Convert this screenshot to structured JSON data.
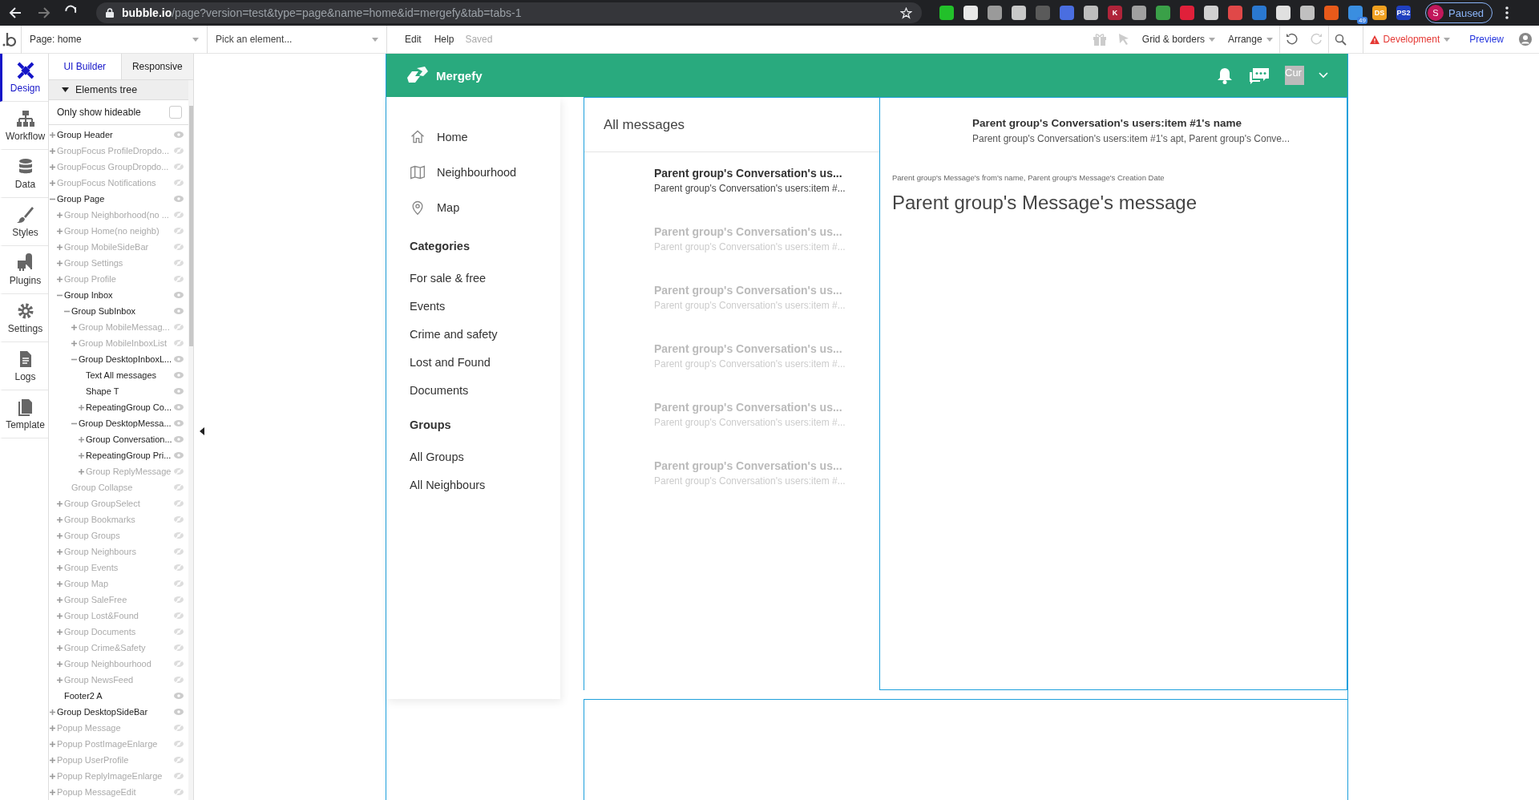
{
  "browser": {
    "url_host": "bubble.io",
    "url_path": "/page?version=test&type=page&name=home&id=mergefy&tab=tabs-1",
    "extensions": [
      {
        "color": "#22c02a"
      },
      {
        "color": "#e8e8e8"
      },
      {
        "color": "#9a9a9a"
      },
      {
        "color": "#c8c8c8"
      },
      {
        "color": "#5a5a5a"
      },
      {
        "color": "#4a6ee0"
      },
      {
        "color": "#bdbdbd"
      },
      {
        "color": "#b0243a",
        "text": "K"
      },
      {
        "color": "#a0a0a0"
      },
      {
        "color": "#3aa048"
      },
      {
        "color": "#e0203a"
      },
      {
        "color": "#d0d0d0"
      },
      {
        "color": "#e04848"
      },
      {
        "color": "#2a78d0"
      },
      {
        "color": "#e0e0e0"
      },
      {
        "color": "#c0c0c0"
      },
      {
        "color": "#e85a1a"
      },
      {
        "color": "#3a8ee0",
        "badge": "49"
      },
      {
        "color": "#f0a020",
        "text": "DS"
      },
      {
        "color": "#2040c0",
        "text": "PS2"
      }
    ],
    "profile": {
      "initial": "S",
      "label": "Paused"
    }
  },
  "editor_toolbar": {
    "page": "Page: home",
    "element_placeholder": "Pick an element...",
    "menus": [
      "Edit",
      "Help"
    ],
    "status": "Saved",
    "right_menus": [
      "Grid & borders",
      "Arrange"
    ],
    "mode": "Development",
    "preview": "Preview"
  },
  "rail": [
    {
      "label": "Design",
      "selected": true
    },
    {
      "label": "Workflow",
      "selected": false
    },
    {
      "label": "Data",
      "selected": false
    },
    {
      "label": "Styles",
      "selected": false
    },
    {
      "label": "Plugins",
      "selected": false
    },
    {
      "label": "Settings",
      "selected": false
    },
    {
      "label": "Logs",
      "selected": false
    },
    {
      "label": "Template",
      "selected": false
    }
  ],
  "panel_tabs": [
    {
      "label": "UI Builder",
      "selected": true
    },
    {
      "label": "Responsive",
      "selected": false
    }
  ],
  "tree_header": "Elements tree",
  "hideable": {
    "label": "Only show hideable",
    "checked": false
  },
  "tree": [
    {
      "label": "Group Header",
      "kind": "group",
      "expanded": false,
      "hidden": false
    },
    {
      "label": "GroupFocus ProfileDropdo...",
      "kind": "group",
      "expanded": false,
      "hidden": true
    },
    {
      "label": "GroupFocus GroupDropdo...",
      "kind": "group",
      "expanded": false,
      "hidden": true
    },
    {
      "label": "GroupFocus Notifications",
      "kind": "group",
      "expanded": false,
      "hidden": true
    },
    {
      "label": "Group Page",
      "kind": "group",
      "expanded": true,
      "hidden": false,
      "children": [
        {
          "label": "Group Neighborhood(no ...",
          "kind": "group",
          "expanded": false,
          "hidden": true
        },
        {
          "label": "Group Home(no neighb)",
          "kind": "group",
          "expanded": false,
          "hidden": true
        },
        {
          "label": "Group MobileSideBar",
          "kind": "group",
          "expanded": false,
          "hidden": true
        },
        {
          "label": "Group Settings",
          "kind": "group",
          "expanded": false,
          "hidden": true
        },
        {
          "label": "Group Profile",
          "kind": "group",
          "expanded": false,
          "hidden": true
        },
        {
          "label": "Group Inbox",
          "kind": "group",
          "expanded": true,
          "hidden": false,
          "children": [
            {
              "label": "Group SubInbox",
              "kind": "group",
              "expanded": true,
              "hidden": false,
              "children": [
                {
                  "label": "Group MobileMessag...",
                  "kind": "group",
                  "expanded": false,
                  "hidden": true
                },
                {
                  "label": "Group MobileInboxList",
                  "kind": "group",
                  "expanded": false,
                  "hidden": true
                },
                {
                  "label": "Group DesktopInboxL...",
                  "kind": "group",
                  "expanded": true,
                  "hidden": false,
                  "children": [
                    {
                      "label": "Text All messages",
                      "kind": "leaf",
                      "hidden": false
                    },
                    {
                      "label": "Shape T",
                      "kind": "leaf",
                      "hidden": false
                    },
                    {
                      "label": "RepeatingGroup Co...",
                      "kind": "group",
                      "expanded": false,
                      "hidden": false
                    }
                  ]
                },
                {
                  "label": "Group DesktopMessa...",
                  "kind": "group",
                  "expanded": true,
                  "hidden": false,
                  "children": [
                    {
                      "label": "Group Conversation...",
                      "kind": "group",
                      "expanded": false,
                      "hidden": false
                    },
                    {
                      "label": "RepeatingGroup Pri...",
                      "kind": "group",
                      "expanded": false,
                      "hidden": false
                    },
                    {
                      "label": "Group ReplyMessage",
                      "kind": "group",
                      "expanded": false,
                      "hidden": true
                    }
                  ]
                }
              ]
            },
            {
              "label": "Group Collapse",
              "kind": "leaf",
              "hidden": true
            }
          ]
        },
        {
          "label": "Group GroupSelect",
          "kind": "group",
          "expanded": false,
          "hidden": true
        },
        {
          "label": "Group Bookmarks",
          "kind": "group",
          "expanded": false,
          "hidden": true
        },
        {
          "label": "Group Groups",
          "kind": "group",
          "expanded": false,
          "hidden": true
        },
        {
          "label": "Group Neighbours",
          "kind": "group",
          "expanded": false,
          "hidden": true
        },
        {
          "label": "Group Events",
          "kind": "group",
          "expanded": false,
          "hidden": true
        },
        {
          "label": "Group Map",
          "kind": "group",
          "expanded": false,
          "hidden": true
        },
        {
          "label": "Group SaleFree",
          "kind": "group",
          "expanded": false,
          "hidden": true
        },
        {
          "label": "Group Lost&Found",
          "kind": "group",
          "expanded": false,
          "hidden": true
        },
        {
          "label": "Group Documents",
          "kind": "group",
          "expanded": false,
          "hidden": true
        },
        {
          "label": "Group Crime&Safety",
          "kind": "group",
          "expanded": false,
          "hidden": true
        },
        {
          "label": "Group Neighbourhood",
          "kind": "group",
          "expanded": false,
          "hidden": true
        },
        {
          "label": "Group NewsFeed",
          "kind": "group",
          "expanded": false,
          "hidden": true
        },
        {
          "label": "Footer2 A",
          "kind": "leaf",
          "hidden": false
        }
      ]
    },
    {
      "label": "Group DesktopSideBar",
      "kind": "group",
      "expanded": false,
      "hidden": false
    },
    {
      "label": "Popup Message",
      "kind": "group",
      "expanded": false,
      "hidden": true
    },
    {
      "label": "Popup PostImageEnlarge",
      "kind": "group",
      "expanded": false,
      "hidden": true
    },
    {
      "label": "Popup UserProfile",
      "kind": "group",
      "expanded": false,
      "hidden": true
    },
    {
      "label": "Popup ReplyImageEnlarge",
      "kind": "group",
      "expanded": false,
      "hidden": true
    },
    {
      "label": "Popup MessageEdit",
      "kind": "group",
      "expanded": false,
      "hidden": true
    }
  ],
  "app": {
    "brand": "Mergefy",
    "avatar_text": "Cur",
    "nav": [
      {
        "kind": "icon-link",
        "label": "Home"
      },
      {
        "kind": "icon-link",
        "label": "Neighbourhood"
      },
      {
        "kind": "icon-link",
        "label": "Map"
      },
      {
        "kind": "heading",
        "label": "Categories"
      },
      {
        "kind": "link",
        "label": "For sale & free"
      },
      {
        "kind": "link",
        "label": "Events"
      },
      {
        "kind": "link",
        "label": "Crime and safety"
      },
      {
        "kind": "link",
        "label": "Lost and Found"
      },
      {
        "kind": "link",
        "label": "Documents"
      },
      {
        "kind": "heading",
        "label": "Groups"
      },
      {
        "kind": "link",
        "label": "All Groups"
      },
      {
        "kind": "link",
        "label": "All Neighbours"
      }
    ],
    "list_title": "All messages",
    "conversations": [
      {
        "title": "Parent group's Conversation's us...",
        "subtitle": "Parent group's Conversation's users:item #...",
        "selected": true
      },
      {
        "title": "Parent group's Conversation's us...",
        "subtitle": "Parent group's Conversation's users:item #...",
        "selected": false
      },
      {
        "title": "Parent group's Conversation's us...",
        "subtitle": "Parent group's Conversation's users:item #...",
        "selected": false
      },
      {
        "title": "Parent group's Conversation's us...",
        "subtitle": "Parent group's Conversation's users:item #...",
        "selected": false
      },
      {
        "title": "Parent group's Conversation's us...",
        "subtitle": "Parent group's Conversation's users:item #...",
        "selected": false
      },
      {
        "title": "Parent group's Conversation's us...",
        "subtitle": "Parent group's Conversation's users:item #...",
        "selected": false
      }
    ],
    "conversation_header": {
      "name": "Parent group's Conversation's users:item #1's name",
      "detail": "Parent group's Conversation's users:item #1's apt, Parent group's Conve..."
    },
    "message": {
      "meta": "Parent group's Message's from's name, Parent group's Message's Creation Date",
      "text": "Parent group's Message's message"
    }
  }
}
